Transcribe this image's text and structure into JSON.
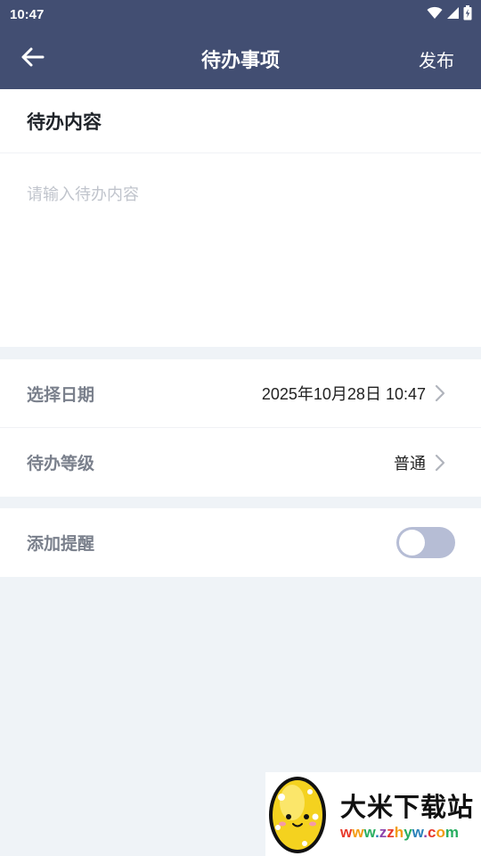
{
  "status_bar": {
    "time": "10:47",
    "icons": [
      "wifi-icon",
      "signal-icon",
      "battery-icon"
    ]
  },
  "app_bar": {
    "back_icon": "arrow-left-icon",
    "title": "待办事项",
    "action_label": "发布"
  },
  "content": {
    "header": "待办内容",
    "value": "",
    "placeholder": "请输入待办内容"
  },
  "settings": {
    "date": {
      "label": "选择日期",
      "value": "2025年10月28日 10:47"
    },
    "level": {
      "label": "待办等级",
      "value": "普通"
    },
    "reminder": {
      "label": "添加提醒",
      "enabled": false
    }
  },
  "watermark": {
    "title": "大米下载站",
    "url": "www.zzhyw.com"
  },
  "colors": {
    "primary": "#424e72",
    "background": "#eff3f7",
    "label": "#7a808c",
    "toggle_off": "#b6bdd5",
    "placeholder": "#c0c4cc"
  }
}
